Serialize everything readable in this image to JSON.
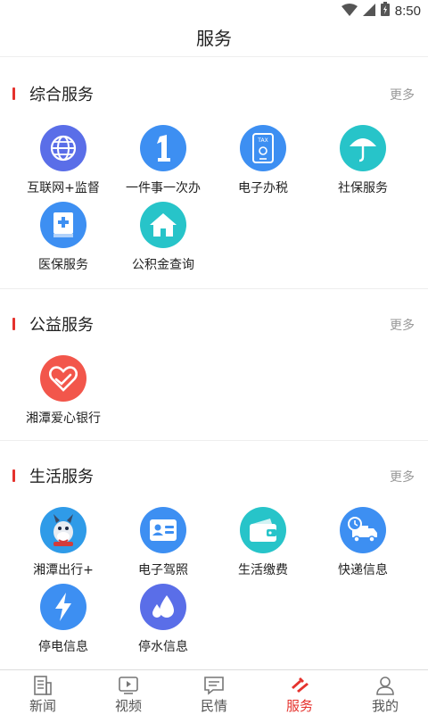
{
  "status_bar": {
    "time": "8:50",
    "icons": [
      "wifi-icon",
      "signal-icon",
      "battery-icon"
    ]
  },
  "header": {
    "title": "服务"
  },
  "colors": {
    "accent": "#e5322d",
    "icon_blue": "#3d8ff2",
    "icon_teal": "#27c4c9",
    "icon_red": "#f2564b",
    "icon_purple": "#5a6ee8"
  },
  "sections": [
    {
      "title": "综合服务",
      "more": "更多",
      "items": [
        {
          "label": "互联网+监督",
          "icon": "globe-icon"
        },
        {
          "label": "一件事一次办",
          "icon": "number-one-icon"
        },
        {
          "label": "电子办税",
          "icon": "tax-phone-icon"
        },
        {
          "label": "社保服务",
          "icon": "umbrella-icon"
        },
        {
          "label": "医保服务",
          "icon": "medical-book-icon"
        },
        {
          "label": "公积金查询",
          "icon": "house-icon"
        }
      ]
    },
    {
      "title": "公益服务",
      "more": "更多",
      "items": [
        {
          "label": "湘潭爱心银行",
          "icon": "heart-hand-icon"
        }
      ]
    },
    {
      "title": "生活服务",
      "more": "更多",
      "items": [
        {
          "label": "湘潭出行+",
          "icon": "donkey-mascot-icon"
        },
        {
          "label": "电子驾照",
          "icon": "id-card-icon"
        },
        {
          "label": "生活缴费",
          "icon": "wallet-icon"
        },
        {
          "label": "快递信息",
          "icon": "delivery-truck-icon"
        },
        {
          "label": "停电信息",
          "icon": "lightning-icon"
        },
        {
          "label": "停水信息",
          "icon": "water-drops-icon"
        }
      ]
    }
  ],
  "tabs": [
    {
      "label": "新闻",
      "icon": "news-icon",
      "active": false
    },
    {
      "label": "视频",
      "icon": "video-icon",
      "active": false
    },
    {
      "label": "民情",
      "icon": "message-icon",
      "active": false
    },
    {
      "label": "服务",
      "icon": "service-icon",
      "active": true
    },
    {
      "label": "我的",
      "icon": "profile-icon",
      "active": false
    }
  ]
}
